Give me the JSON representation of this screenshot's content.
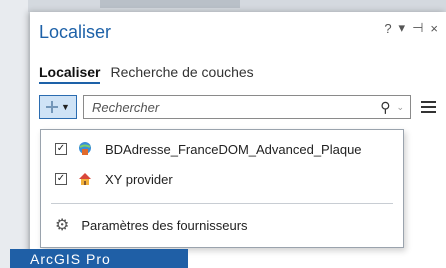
{
  "panel": {
    "title": "Localiser",
    "controls": {
      "help": "?",
      "menu": "▾",
      "pin": "⊣",
      "close": "×"
    }
  },
  "tabs": [
    {
      "label": "Localiser",
      "active": true
    },
    {
      "label": "Recherche de couches",
      "active": false
    }
  ],
  "search": {
    "placeholder": "Rechercher"
  },
  "providers": [
    {
      "label": "BDAdresse_FranceDOM_Advanced_Plaque",
      "checked": true,
      "icon": "globe-address-icon"
    },
    {
      "label": "XY provider",
      "checked": true,
      "icon": "house-pin-icon"
    }
  ],
  "settings": {
    "label": "Paramètres des fournisseurs",
    "icon": "gear-icon"
  },
  "bottom_bar": {
    "text": "ArcGIS Pro"
  },
  "colors": {
    "accent": "#1d61a8",
    "bottom_bar": "#1f5fa6",
    "button_bg": "#cfe3f6"
  }
}
